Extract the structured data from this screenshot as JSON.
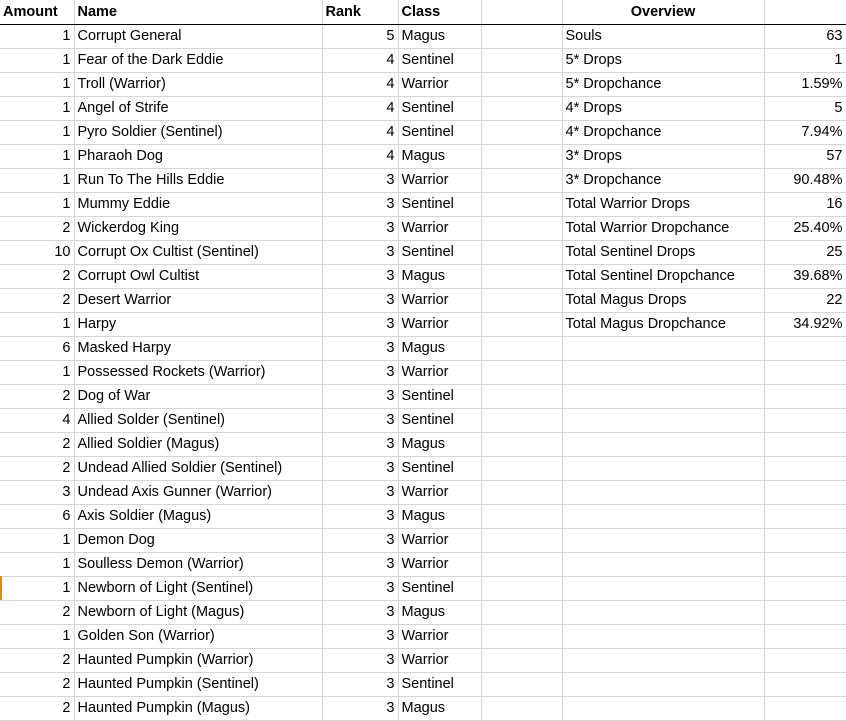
{
  "sheet": {
    "headers": {
      "amount": "Amount",
      "name": "Name",
      "rank": "Rank",
      "class": "Class",
      "spacer": "",
      "overview": "Overview",
      "overview_value": ""
    },
    "rows": [
      {
        "amount": "1",
        "name": "Corrupt General",
        "rank": "5",
        "class": "Magus"
      },
      {
        "amount": "1",
        "name": "Fear of the Dark Eddie",
        "rank": "4",
        "class": "Sentinel"
      },
      {
        "amount": "1",
        "name": "Troll (Warrior)",
        "rank": "4",
        "class": "Warrior"
      },
      {
        "amount": "1",
        "name": "Angel of Strife",
        "rank": "4",
        "class": "Sentinel"
      },
      {
        "amount": "1",
        "name": "Pyro Soldier (Sentinel)",
        "rank": "4",
        "class": "Sentinel"
      },
      {
        "amount": "1",
        "name": "Pharaoh Dog",
        "rank": "4",
        "class": "Magus"
      },
      {
        "amount": "1",
        "name": "Run To The Hills Eddie",
        "rank": "3",
        "class": "Warrior"
      },
      {
        "amount": "1",
        "name": "Mummy Eddie",
        "rank": "3",
        "class": "Sentinel"
      },
      {
        "amount": "2",
        "name": "Wickerdog King",
        "rank": "3",
        "class": "Warrior"
      },
      {
        "amount": "10",
        "name": "Corrupt Ox Cultist (Sentinel)",
        "rank": "3",
        "class": "Sentinel"
      },
      {
        "amount": "2",
        "name": "Corrupt Owl Cultist",
        "rank": "3",
        "class": "Magus"
      },
      {
        "amount": "2",
        "name": "Desert Warrior",
        "rank": "3",
        "class": "Warrior"
      },
      {
        "amount": "1",
        "name": "Harpy",
        "rank": "3",
        "class": "Warrior"
      },
      {
        "amount": "6",
        "name": "Masked Harpy",
        "rank": "3",
        "class": "Magus"
      },
      {
        "amount": "1",
        "name": "Possessed Rockets (Warrior)",
        "rank": "3",
        "class": "Warrior"
      },
      {
        "amount": "2",
        "name": "Dog of War",
        "rank": "3",
        "class": "Sentinel"
      },
      {
        "amount": "4",
        "name": "Allied Solder (Sentinel)",
        "rank": "3",
        "class": "Sentinel"
      },
      {
        "amount": "2",
        "name": "Allied Soldier (Magus)",
        "rank": "3",
        "class": "Magus"
      },
      {
        "amount": "2",
        "name": "Undead Allied Soldier (Sentinel)",
        "rank": "3",
        "class": "Sentinel"
      },
      {
        "amount": "3",
        "name": "Undead Axis Gunner (Warrior)",
        "rank": "3",
        "class": "Warrior"
      },
      {
        "amount": "6",
        "name": "Axis Soldier (Magus)",
        "rank": "3",
        "class": "Magus"
      },
      {
        "amount": "1",
        "name": "Demon Dog",
        "rank": "3",
        "class": "Warrior"
      },
      {
        "amount": "1",
        "name": "Soulless Demon (Warrior)",
        "rank": "3",
        "class": "Warrior"
      },
      {
        "amount": "1",
        "name": "Newborn of Light (Sentinel)",
        "rank": "3",
        "class": "Sentinel"
      },
      {
        "amount": "2",
        "name": "Newborn of Light (Magus)",
        "rank": "3",
        "class": "Magus"
      },
      {
        "amount": "1",
        "name": "Golden Son (Warrior)",
        "rank": "3",
        "class": "Warrior"
      },
      {
        "amount": "2",
        "name": "Haunted Pumpkin (Warrior)",
        "rank": "3",
        "class": "Warrior"
      },
      {
        "amount": "2",
        "name": "Haunted Pumpkin (Sentinel)",
        "rank": "3",
        "class": "Sentinel"
      },
      {
        "amount": "2",
        "name": "Haunted Pumpkin (Magus)",
        "rank": "3",
        "class": "Magus"
      }
    ],
    "overview": [
      {
        "label": "Souls",
        "value": "63"
      },
      {
        "label": "5* Drops",
        "value": "1"
      },
      {
        "label": "5* Dropchance",
        "value": "1.59%"
      },
      {
        "label": "4* Drops",
        "value": "5"
      },
      {
        "label": "4* Dropchance",
        "value": "7.94%"
      },
      {
        "label": "3* Drops",
        "value": "57"
      },
      {
        "label": "3* Dropchance",
        "value": "90.48%"
      },
      {
        "label": "Total Warrior Drops",
        "value": "16"
      },
      {
        "label": "Total Warrior Dropchance",
        "value": "25.40%"
      },
      {
        "label": "Total Sentinel Drops",
        "value": "25"
      },
      {
        "label": "Total Sentinel Dropchance",
        "value": "39.68%"
      },
      {
        "label": "Total Magus Drops",
        "value": "22"
      },
      {
        "label": "Total Magus Dropchance",
        "value": "34.92%"
      }
    ],
    "selection": {
      "row_index": 23,
      "marker_color": "#d98c22"
    },
    "grid_color": "#d6d6d6"
  }
}
